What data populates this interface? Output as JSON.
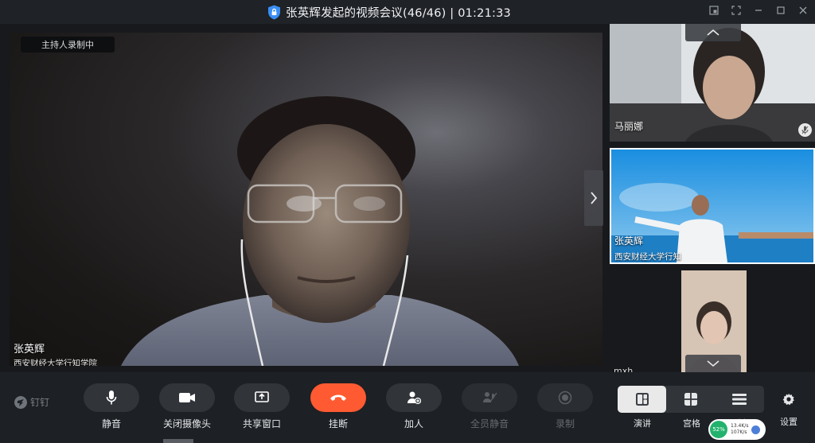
{
  "window": {
    "title": "张英辉发起的视频会议(46/46) | 01:21:33",
    "lock_icon": "shield-lock-icon"
  },
  "main_video": {
    "recording_badge": "主持人录制中",
    "speaker_name": "张英辉",
    "speaker_org": "西安财经大学行知学院"
  },
  "participants": [
    {
      "name": "马丽娜",
      "muted": true
    },
    {
      "name": "张英辉",
      "org": "西安财经大学行知"
    },
    {
      "name": "mxh"
    }
  ],
  "toolbar": {
    "brand": "钉钉",
    "mute_label": "静音",
    "camera_label": "关闭摄像头",
    "share_label": "共享窗口",
    "hangup_label": "挂断",
    "invite_label": "加人",
    "mute_all_label": "全员静音",
    "record_label": "录制",
    "layout_speaker_label": "演讲",
    "layout_grid_label": "宫格",
    "layout_list_label": "列表",
    "settings_label": "设置",
    "hangup_color": "#ff5a32"
  },
  "network": {
    "quality": "52%",
    "upload": "13.4K/s",
    "download": "107K/s"
  }
}
